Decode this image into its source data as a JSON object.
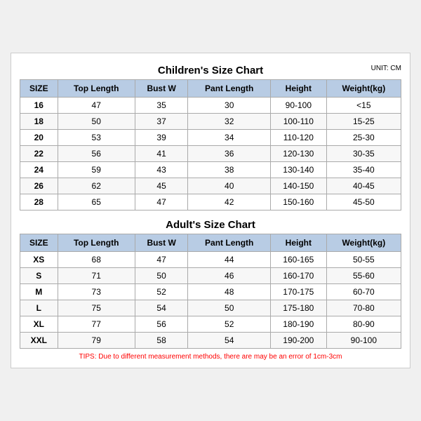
{
  "children_title": "Children's Size Chart",
  "adults_title": "Adult's Size Chart",
  "unit_label": "UNIT: CM",
  "headers": [
    "SIZE",
    "Top Length",
    "Bust W",
    "Pant Length",
    "Height",
    "Weight(kg)"
  ],
  "children_rows": [
    [
      "16",
      "47",
      "35",
      "30",
      "90-100",
      "<15"
    ],
    [
      "18",
      "50",
      "37",
      "32",
      "100-110",
      "15-25"
    ],
    [
      "20",
      "53",
      "39",
      "34",
      "110-120",
      "25-30"
    ],
    [
      "22",
      "56",
      "41",
      "36",
      "120-130",
      "30-35"
    ],
    [
      "24",
      "59",
      "43",
      "38",
      "130-140",
      "35-40"
    ],
    [
      "26",
      "62",
      "45",
      "40",
      "140-150",
      "40-45"
    ],
    [
      "28",
      "65",
      "47",
      "42",
      "150-160",
      "45-50"
    ]
  ],
  "adult_rows": [
    [
      "XS",
      "68",
      "47",
      "44",
      "160-165",
      "50-55"
    ],
    [
      "S",
      "71",
      "50",
      "46",
      "160-170",
      "55-60"
    ],
    [
      "M",
      "73",
      "52",
      "48",
      "170-175",
      "60-70"
    ],
    [
      "L",
      "75",
      "54",
      "50",
      "175-180",
      "70-80"
    ],
    [
      "XL",
      "77",
      "56",
      "52",
      "180-190",
      "80-90"
    ],
    [
      "XXL",
      "79",
      "58",
      "54",
      "190-200",
      "90-100"
    ]
  ],
  "tips": "TIPS: Due to different measurement methods, there are may be an error of 1cm-3cm"
}
